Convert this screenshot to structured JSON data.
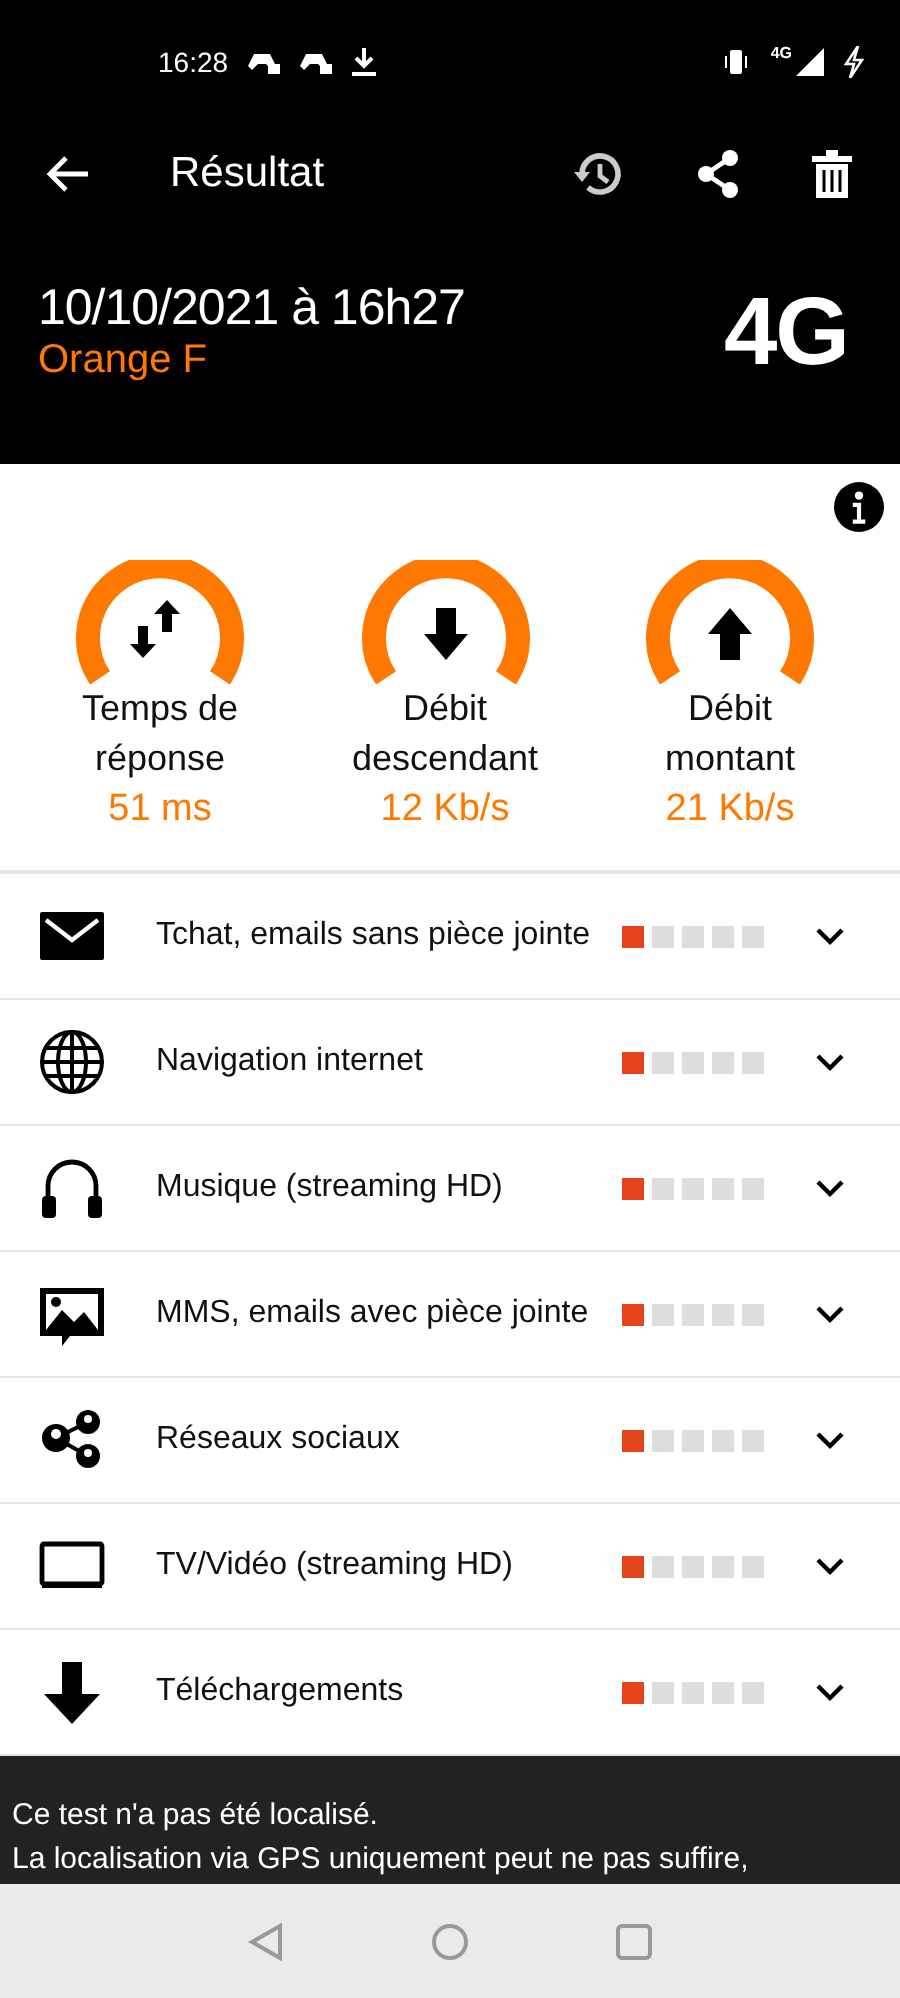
{
  "status_bar": {
    "time": "16:28",
    "network": "4G"
  },
  "toolbar": {
    "title": "Résultat"
  },
  "header": {
    "date": "10/10/2021 à 16h27",
    "operator": "Orange F",
    "technology": "4G"
  },
  "metrics": [
    {
      "kind": "latency",
      "label": "Temps de réponse",
      "value": "51 ms"
    },
    {
      "kind": "download",
      "label": "Débit descendant",
      "value": "12 Kb/s"
    },
    {
      "kind": "upload",
      "label": "Débit montant",
      "value": "21 Kb/s"
    }
  ],
  "usages": [
    {
      "kind": "mail",
      "label": "Tchat, emails sans pièce jointe",
      "level": 0.2,
      "expanded": false
    },
    {
      "kind": "globe",
      "label": "Navigation internet",
      "level": 0.2,
      "expanded": false
    },
    {
      "kind": "headphones",
      "label": "Musique (streaming HD)",
      "level": 0.2,
      "expanded": false
    },
    {
      "kind": "image",
      "label": "MMS, emails avec pièce jointe",
      "level": 0.2,
      "expanded": false
    },
    {
      "kind": "social",
      "label": "Réseaux sociaux",
      "level": 0.2,
      "expanded": false
    },
    {
      "kind": "tv",
      "label": "TV/Vidéo (streaming HD)",
      "level": 0.2,
      "expanded": false
    },
    {
      "kind": "download",
      "label": "Téléchargements",
      "level": 0.2,
      "expanded": false
    }
  ],
  "footer": {
    "lines": [
      "Ce test n'a pas été localisé.",
      "La localisation via GPS uniquement peut ne pas suffire,"
    ]
  }
}
